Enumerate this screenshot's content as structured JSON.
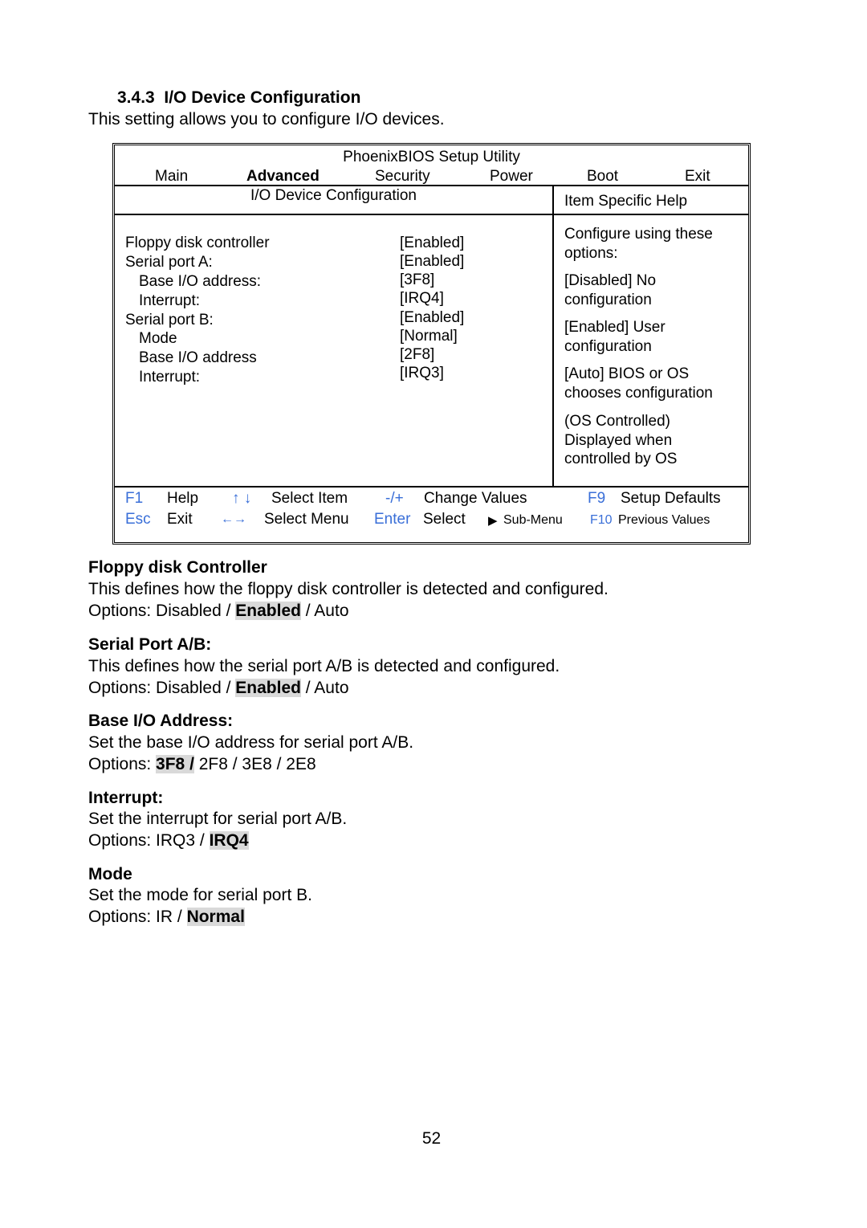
{
  "section": {
    "number": "3.4.3",
    "title": "I/O Device Configuration",
    "intro": "This setting allows you to configure I/O devices."
  },
  "bios": {
    "utility_title": "PhoenixBIOS Setup Utility",
    "menu": [
      "Main",
      "Advanced",
      "Security",
      "Power",
      "Boot",
      "Exit"
    ],
    "active_menu": "Advanced",
    "screen_title": "I/O Device Configuration",
    "help_title": "Item Specific Help",
    "items": [
      {
        "label": "Floppy disk controller",
        "value": "[Enabled]"
      },
      {
        "label": "Serial port A:",
        "value": "[Enabled]"
      },
      {
        "label": "Base I/O address:",
        "value": "[3F8]"
      },
      {
        "label": "Interrupt:",
        "value": "[IRQ4]"
      },
      {
        "label": "Serial port B:",
        "value": "[Enabled]"
      },
      {
        "label": "Mode",
        "value": "[Normal]"
      },
      {
        "label": "Base I/O address",
        "value": "[2F8]"
      },
      {
        "label": "Interrupt:",
        "value": "[IRQ3]"
      }
    ],
    "help": [
      [
        "Configure using these",
        "options:"
      ],
      [
        "[Disabled] No",
        "configuration"
      ],
      [
        "[Enabled]  User",
        "configuration"
      ],
      [
        "[Auto] BIOS or OS",
        "chooses configuration"
      ],
      [
        "(OS Controlled)",
        "Displayed when",
        "controlled by OS"
      ]
    ],
    "keys_row1": [
      {
        "key": "F1",
        "desc": "Help"
      },
      {
        "key": "↑ ↓",
        "desc": "Select Item"
      },
      {
        "key": "-/+",
        "desc": "Change Values"
      },
      {
        "key": "F9",
        "desc": "Setup Defaults"
      }
    ],
    "keys_row2": [
      {
        "key": "Esc",
        "desc": "Exit"
      },
      {
        "key": "←→",
        "desc": "Select Menu"
      },
      {
        "key": "Enter",
        "desc": "Select"
      },
      {
        "key": "▶",
        "desc": "Sub-Menu"
      },
      {
        "key": "F10",
        "desc": "Previous Values"
      }
    ],
    "key_color": "#3a6fd8"
  },
  "descriptions": [
    {
      "heading": "Floppy disk Controller",
      "text": "This defines how the floppy disk controller is detected and configured.",
      "options_prefix": "Options: ",
      "options_pre": "Disabled / ",
      "options_default": "Enabled",
      "options_post": " / Auto"
    },
    {
      "heading": "Serial Port A/B:",
      "text": "This defines how the serial port A/B is detected and configured.",
      "options_prefix": "Options: ",
      "options_pre": "Disabled / ",
      "options_default": "Enabled",
      "options_post": " / Auto"
    },
    {
      "heading": "Base I/O Address:",
      "text": "Set the base I/O address for serial port A/B.",
      "options_prefix": "Options: ",
      "options_pre": "",
      "options_default": "3F8 /",
      "options_post": " 2F8 / 3E8 / 2E8"
    },
    {
      "heading": "Interrupt:",
      "text": "Set the interrupt for serial port A/B.",
      "options_prefix": "Options: ",
      "options_pre": "IRQ3 / ",
      "options_default": "IRQ4",
      "options_post": ""
    },
    {
      "heading": "Mode",
      "text": "Set the mode for serial port B.",
      "options_prefix": "Options: ",
      "options_pre": "IR / ",
      "options_default": "Normal",
      "options_post": ""
    }
  ],
  "page_number": "52"
}
